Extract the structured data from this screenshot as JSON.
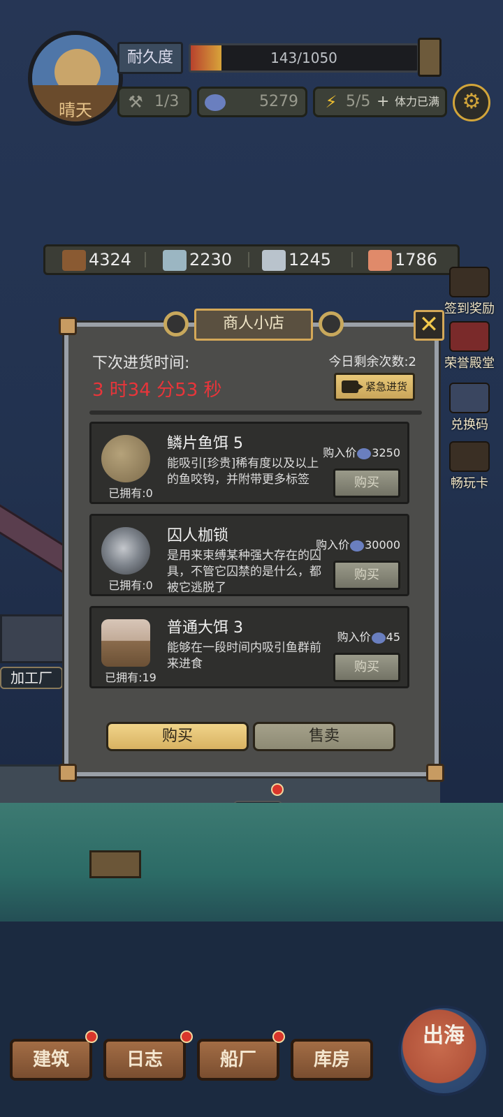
{
  "hud": {
    "weather": "晴天",
    "durability_label": "耐久度",
    "durability_value": "143/1050",
    "durability_fraction": 0.136,
    "repair_count": "1/3",
    "coins": "5279",
    "stamina": "5/5",
    "stamina_plus": "+",
    "stamina_status": "体力已满"
  },
  "resources": [
    {
      "name": "wood",
      "value": "4324",
      "color": "#8a5a32"
    },
    {
      "name": "cloth",
      "value": "2230",
      "color": "#9bb6c2"
    },
    {
      "name": "iron",
      "value": "1245",
      "color": "#b9c3cc"
    },
    {
      "name": "fish",
      "value": "1786",
      "color": "#e08a6a"
    }
  ],
  "side_icons": [
    "签到奖励",
    "荣誉殿堂",
    "兑换码",
    "畅玩卡"
  ],
  "scene_labels": {
    "factory": "加工厂",
    "shipyard": "船厂"
  },
  "shop": {
    "title": "商人小店",
    "close": "✕",
    "restock_label": "下次进货时间:",
    "restock_time": "3 时34 分53 秒",
    "remaining": "今日剩余次数:2",
    "urgent": "紧急进货",
    "items": [
      {
        "name": "鳞片鱼饵 5",
        "desc": "能吸引[珍贵]稀有度以及以上的鱼咬钩，并附带更多标签",
        "owned": "已拥有:0",
        "price_label": "购入价",
        "price": "3250",
        "buy": "购买"
      },
      {
        "name": "囚人枷锁",
        "desc": "是用来束缚某种强大存在的囚具，不管它囚禁的是什么，都被它逃脱了",
        "owned": "已拥有:0",
        "price_label": "购入价",
        "price": "30000",
        "buy": "购买"
      },
      {
        "name": "普通大饵 3",
        "desc": "能够在一段时间内吸引鱼群前来进食",
        "owned": "已拥有:19",
        "price_label": "购入价",
        "price": "45",
        "buy": "购买"
      }
    ],
    "tab_buy": "购买",
    "tab_sell": "售卖"
  },
  "bottom_nav": [
    "建筑",
    "日志",
    "船厂",
    "库房"
  ],
  "sail_button": "出海",
  "colors": {
    "accent": "#d4a858",
    "timer_red": "#e8353a",
    "buy_gold": "#e8c878"
  }
}
